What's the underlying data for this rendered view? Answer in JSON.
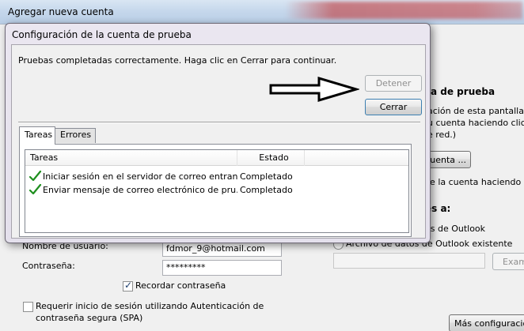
{
  "background_window": {
    "title": "Agregar nueva cuenta",
    "right_panel": {
      "heading_fragment": "a de prueba",
      "para_line1": "ación de esta pantalla, le",
      "para_line2": "u cuenta haciendo clic en",
      "para_line3": "e red.)",
      "test_button_fragment": "uenta ...",
      "auto_test_fragment": "le la cuenta haciendo clic",
      "deliver_heading_fragment": "es a:",
      "opt_new_fragment": "os de Outlook",
      "opt_existing_label": "Archivo de datos de Outlook existente",
      "browse_button_fragment": "Exam",
      "more_settings_button": "Más configuraciones"
    },
    "form": {
      "username_label": "Nombre de usuario:",
      "username_value": "fdmor_9@hotmail.com",
      "password_label": "Contraseña:",
      "password_value": "*********",
      "remember_label": "Recordar contraseña",
      "remember_checked": true,
      "spa_label_line1": "Requerir inicio de sesión utilizando Autenticación de",
      "spa_label_line2": "contraseña segura (SPA)",
      "spa_checked": false
    }
  },
  "dialog": {
    "title": "Configuración de la cuenta de prueba",
    "status": "Pruebas completadas correctamente. Haga clic en Cerrar para continuar.",
    "stop_button": "Detener",
    "close_button": "Cerrar",
    "tabs": [
      {
        "label": "Tareas",
        "active": true
      },
      {
        "label": "Errores",
        "active": false
      }
    ],
    "columns": [
      "Tareas",
      "Estado"
    ],
    "rows": [
      {
        "task": "Iniciar sesión en el servidor de correo entran...",
        "status": "Completado",
        "icon": "green-check-icon"
      },
      {
        "task": "Enviar mensaje de correo electrónico de pru...",
        "status": "Completado",
        "icon": "green-check-icon"
      }
    ]
  },
  "colors": {
    "check_green": "#1e8f1e",
    "title_blur_red": "#be2828"
  }
}
